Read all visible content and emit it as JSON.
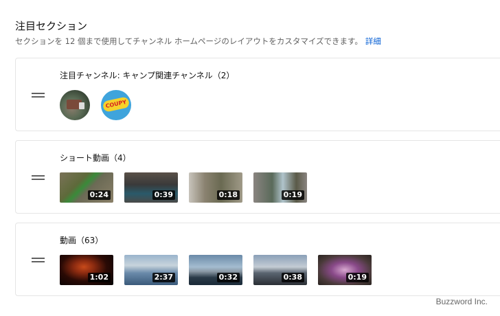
{
  "header": {
    "title": "注目セクション",
    "description": "セクションを 12 個まで使用してチャンネル ホームページのレイアウトをカスタマイズできます。",
    "learn_more": "詳細"
  },
  "sections": [
    {
      "title": "注目チャンネル: キャンプ関連チャンネル（2）",
      "channels": [
        {
          "icon": "truck-channel-avatar"
        },
        {
          "icon": "coupy-channel-avatar",
          "logo_text": "COUPY"
        }
      ]
    },
    {
      "title": "ショート動画（4）",
      "items": [
        {
          "duration": "0:24"
        },
        {
          "duration": "0:39"
        },
        {
          "duration": "0:18"
        },
        {
          "duration": "0:19"
        }
      ]
    },
    {
      "title": "動画（63）",
      "items": [
        {
          "duration": "1:02"
        },
        {
          "duration": "2:37"
        },
        {
          "duration": "0:32"
        },
        {
          "duration": "0:38"
        },
        {
          "duration": "0:19"
        }
      ]
    }
  ],
  "watermark": "Buzzword Inc."
}
